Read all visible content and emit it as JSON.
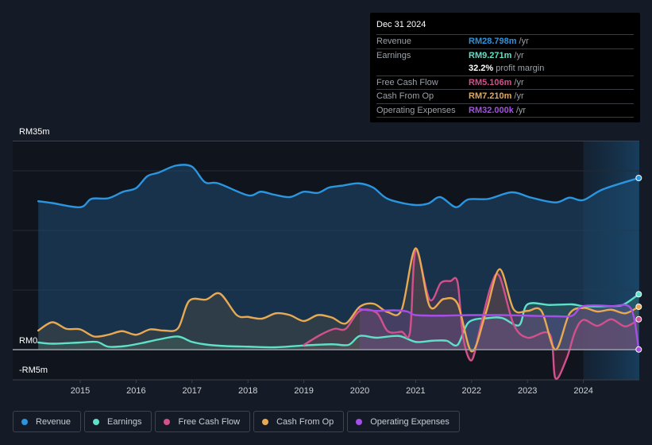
{
  "tooltip": {
    "date": "Dec 31 2024",
    "rows": [
      {
        "label": "Revenue",
        "value": "RM28.798m",
        "unit": "/yr",
        "color": "#2b95e0"
      },
      {
        "label": "Earnings",
        "value": "RM9.271m",
        "unit": "/yr",
        "color": "#5fe0c8"
      },
      {
        "label": "",
        "value": "32.2%",
        "unit": "profit margin",
        "color": "#ffffff"
      },
      {
        "label": "Free Cash Flow",
        "value": "RM5.106m",
        "unit": "/yr",
        "color": "#d2508c"
      },
      {
        "label": "Cash From Op",
        "value": "RM7.210m",
        "unit": "/yr",
        "color": "#e8a953"
      },
      {
        "label": "Operating Expenses",
        "value": "RM32.000k",
        "unit": "/yr",
        "color": "#a64ee8"
      }
    ]
  },
  "legend": [
    {
      "label": "Revenue",
      "color": "#2b95e0"
    },
    {
      "label": "Earnings",
      "color": "#5fe0c8"
    },
    {
      "label": "Free Cash Flow",
      "color": "#d2508c"
    },
    {
      "label": "Cash From Op",
      "color": "#e8a953"
    },
    {
      "label": "Operating Expenses",
      "color": "#a64ee8"
    }
  ],
  "chart_data": {
    "type": "area",
    "title": "",
    "xlabel": "",
    "ylabel": "",
    "y_unit": "RM m",
    "ylim": [
      -5,
      35
    ],
    "y_tick_labels": [
      "RM35m",
      "RM0",
      "-RM5m"
    ],
    "x_tick_labels": [
      "2015",
      "2016",
      "2017",
      "2018",
      "2019",
      "2020",
      "2021",
      "2022",
      "2023",
      "2024"
    ],
    "xlim": [
      2014.0,
      2025.0
    ],
    "forecast_shade_start": 2024.0,
    "series": [
      {
        "name": "Revenue",
        "color": "#2b95e0",
        "x": [
          2014.25,
          2014.5,
          2015.0,
          2015.2,
          2015.5,
          2015.77,
          2016.0,
          2016.2,
          2016.4,
          2016.72,
          2017.0,
          2017.23,
          2017.47,
          2018.0,
          2018.23,
          2018.47,
          2018.75,
          2019.0,
          2019.25,
          2019.45,
          2019.67,
          2019.98,
          2020.24,
          2020.5,
          2020.95,
          2021.22,
          2021.44,
          2021.72,
          2021.94,
          2022.3,
          2022.72,
          2023.07,
          2023.5,
          2023.75,
          2024.0,
          2024.35,
          2024.99
        ],
        "y": [
          24.9,
          24.6,
          23.9,
          25.3,
          25.4,
          26.5,
          27.1,
          29.1,
          29.7,
          30.9,
          30.7,
          28.1,
          27.9,
          25.9,
          26.5,
          26.0,
          25.6,
          26.5,
          26.3,
          27.2,
          27.5,
          27.9,
          27.2,
          25.3,
          24.3,
          24.5,
          25.6,
          23.9,
          25.2,
          25.3,
          26.4,
          25.5,
          24.7,
          25.5,
          25.1,
          26.9,
          28.8
        ]
      },
      {
        "name": "Earnings",
        "color": "#5fe0c8",
        "x": [
          2014.25,
          2014.5,
          2015.0,
          2015.3,
          2015.5,
          2015.8,
          2016.1,
          2016.4,
          2016.75,
          2017.0,
          2017.3,
          2017.6,
          2018.0,
          2018.5,
          2019.0,
          2019.5,
          2019.8,
          2020.0,
          2020.3,
          2020.7,
          2021.0,
          2021.3,
          2021.55,
          2021.75,
          2021.95,
          2022.3,
          2022.55,
          2022.85,
          2023.0,
          2023.4,
          2023.8,
          2024.0,
          2024.4,
          2024.7,
          2024.99
        ],
        "y": [
          1.2,
          1.0,
          1.2,
          1.3,
          0.5,
          0.6,
          1.1,
          1.7,
          2.2,
          1.3,
          0.8,
          0.6,
          0.5,
          0.4,
          0.7,
          0.9,
          0.8,
          2.3,
          2.0,
          2.3,
          1.3,
          1.5,
          1.5,
          0.8,
          4.6,
          5.3,
          5.3,
          4.1,
          7.6,
          7.5,
          7.6,
          7.3,
          7.3,
          7.5,
          9.3
        ]
      },
      {
        "name": "Free Cash Flow",
        "color": "#d2508c",
        "x": [
          2019.0,
          2019.3,
          2019.55,
          2019.75,
          2020.0,
          2020.3,
          2020.5,
          2020.75,
          2020.9,
          2021.0,
          2021.25,
          2021.45,
          2021.62,
          2021.75,
          2021.85,
          2022.0,
          2022.15,
          2022.35,
          2022.5,
          2022.75,
          2023.0,
          2023.4,
          2023.5,
          2023.7,
          2023.85,
          2024.0,
          2024.25,
          2024.5,
          2024.75,
          2024.99
        ],
        "y": [
          0.8,
          2.5,
          3.5,
          3.5,
          6.5,
          6.2,
          3.1,
          3.0,
          3.0,
          16.7,
          8.4,
          11.2,
          11.5,
          11.3,
          2.0,
          -1.8,
          3.5,
          10.8,
          12.3,
          4.3,
          2.0,
          2.6,
          -4.8,
          -1.5,
          3.0,
          5.0,
          4.0,
          5.1,
          3.9,
          5.1
        ]
      },
      {
        "name": "Cash From Op",
        "color": "#e8a953",
        "x": [
          2014.25,
          2014.5,
          2014.75,
          2015.0,
          2015.25,
          2015.5,
          2015.75,
          2016.0,
          2016.25,
          2016.5,
          2016.75,
          2016.95,
          2017.25,
          2017.5,
          2017.8,
          2018.0,
          2018.25,
          2018.5,
          2018.75,
          2019.0,
          2019.25,
          2019.5,
          2019.75,
          2020.0,
          2020.25,
          2020.5,
          2020.75,
          2021.0,
          2021.25,
          2021.5,
          2021.75,
          2022.0,
          2022.25,
          2022.5,
          2022.75,
          2023.0,
          2023.25,
          2023.5,
          2023.75,
          2024.0,
          2024.25,
          2024.5,
          2024.75,
          2024.99
        ],
        "y": [
          3.2,
          4.6,
          3.5,
          3.4,
          2.2,
          2.5,
          3.1,
          2.5,
          3.4,
          3.2,
          3.6,
          8.2,
          8.4,
          9.4,
          5.8,
          5.5,
          5.2,
          6.1,
          5.8,
          4.8,
          5.8,
          5.4,
          4.4,
          7.2,
          7.7,
          6.3,
          6.7,
          17.0,
          7.3,
          8.5,
          7.7,
          -0.3,
          6.0,
          13.5,
          6.8,
          6.5,
          6.5,
          0.0,
          6.0,
          7.0,
          6.4,
          6.7,
          6.1,
          7.2
        ]
      },
      {
        "name": "Operating Expenses",
        "color": "#a64ee8",
        "x": [
          2020.0,
          2020.3,
          2020.6,
          2020.85,
          2021.0,
          2021.5,
          2022.0,
          2022.5,
          2023.0,
          2023.5,
          2023.8,
          2024.0,
          2024.5,
          2024.85,
          2024.99
        ],
        "y": [
          6.8,
          6.5,
          6.6,
          6.4,
          5.8,
          5.7,
          5.8,
          5.8,
          5.7,
          5.6,
          5.7,
          7.3,
          7.3,
          6.9,
          0.03
        ]
      }
    ]
  }
}
